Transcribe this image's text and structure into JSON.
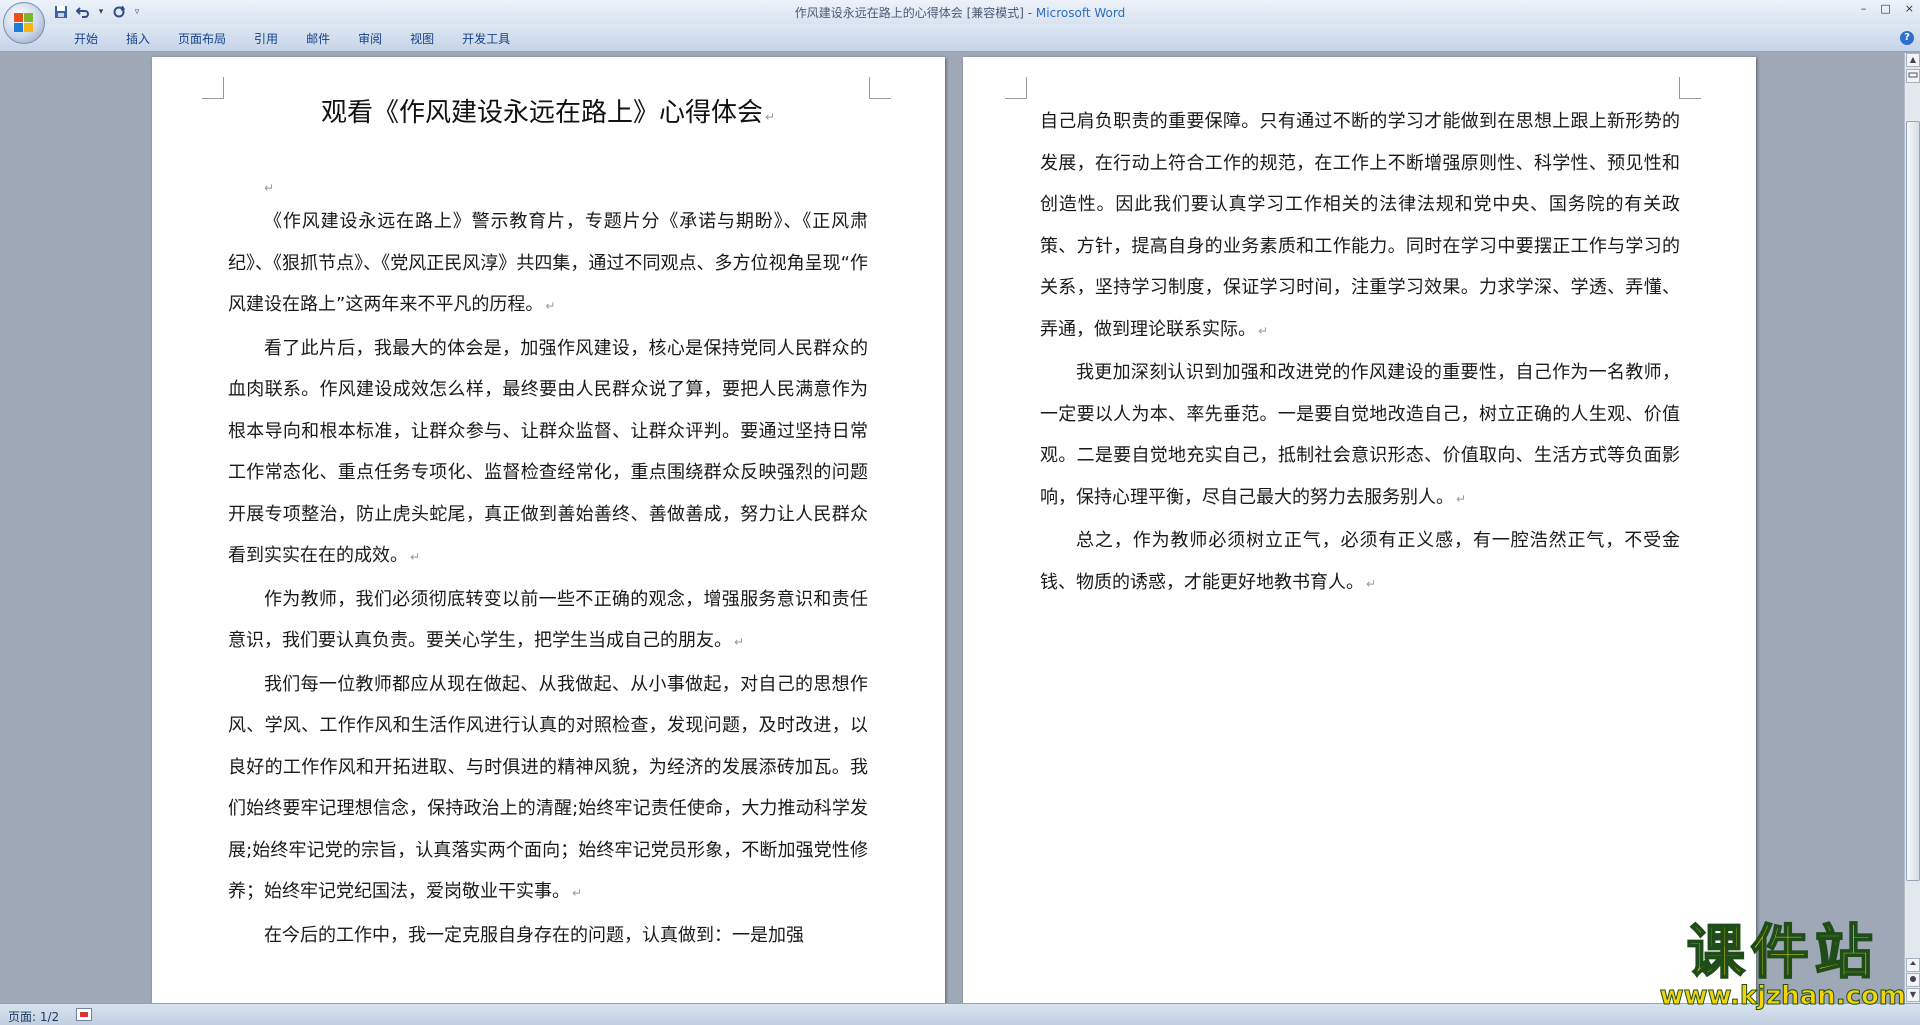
{
  "window": {
    "title_doc": "作风建设永远在路上的心得体会 [兼容模式] - ",
    "title_app": "Microsoft Word",
    "minimize": "–",
    "maximize": "□",
    "close": "×"
  },
  "quick_access": {
    "save_icon": "save-icon",
    "undo_icon": "undo-icon",
    "redo_icon": "redo-icon",
    "dropdown": "▾",
    "customize": "▿"
  },
  "ribbon": {
    "tabs": [
      {
        "label": "开始"
      },
      {
        "label": "插入"
      },
      {
        "label": "页面布局"
      },
      {
        "label": "引用"
      },
      {
        "label": "邮件"
      },
      {
        "label": "审阅"
      },
      {
        "label": "视图"
      },
      {
        "label": "开发工具"
      }
    ],
    "help": "?"
  },
  "document": {
    "title": "观看《作风建设永远在路上》心得体会",
    "para_mark": "↵",
    "page1": [
      "《作风建设永远在路上》警示教育片，专题片分《承诺与期盼》、《正风肃纪》、《狠抓节点》、《党风正民风淳》共四集，通过不同观点、多方位视角呈现“作风建设在路上”这两年来不平凡的历程。",
      "看了此片后，我最大的体会是，加强作风建设，核心是保持党同人民群众的血肉联系。作风建设成效怎么样，最终要由人民群众说了算，要把人民满意作为根本导向和根本标准，让群众参与、让群众监督、让群众评判。要通过坚持日常工作常态化、重点任务专项化、监督检查经常化，重点围绕群众反映强烈的问题开展专项整治，防止虎头蛇尾，真正做到善始善终、善做善成，努力让人民群众看到实实在在的成效。",
      "作为教师，我们必须彻底转变以前一些不正确的观念，增强服务意识和责任意识，我们要认真负责。要关心学生，把学生当成自己的朋友。",
      "我们每一位教师都应从现在做起、从我做起、从小事做起，对自己的思想作风、学风、工作作风和生活作风进行认真的对照检查，发现问题，及时改进，以良好的工作作风和开拓进取、与时俱进的精神风貌，为经济的发展添砖加瓦。我们始终要牢记理想信念，保持政治上的清醒;始终牢记责任使命，大力推动科学发展;始终牢记党的宗旨，认真落实两个面向；始终牢记党员形象，不断加强党性修养；始终牢记党纪国法，爱岗敬业干实事。",
      "在今后的工作中，我一定克服自身存在的问题，认真做到：一是加强"
    ],
    "page2": [
      "自己肩负职责的重要保障。只有通过不断的学习才能做到在思想上跟上新形势的发展，在行动上符合工作的规范，在工作上不断增强原则性、科学性、预见性和创造性。因此我们要认真学习工作相关的法律法规和党中央、国务院的有关政策、方针，提高自身的业务素质和工作能力。同时在学习中要摆正工作与学习的关系，坚持学习制度，保证学习时间，注重学习效果。力求学深、学透、弄懂、弄通，做到理论联系实际。",
      "我更加深刻认识到加强和改进党的作风建设的重要性，自己作为一名教师，一定要以人为本、率先垂范。一是要自觉地改造自己，树立正确的人生观、价值观。二是要自觉地充实自己，抵制社会意识形态、价值取向、生活方式等负面影响，保持心理平衡，尽自己最大的努力去服务别人。",
      "总之，作为教师必须树立正气，必须有正义感，有一腔浩然正气，不受金钱、物质的诱惑，才能更好地教书育人。"
    ]
  },
  "scrollbar": {
    "up": "▲",
    "down": "▼"
  },
  "status": {
    "page": "页面: 1/2"
  },
  "watermark": {
    "title": "课件站",
    "url": "www.kjzhan.com"
  },
  "colors": {
    "ribbon_text": "#15428b",
    "brand": "#2b6cc4",
    "watermark": "#f2d40a"
  }
}
